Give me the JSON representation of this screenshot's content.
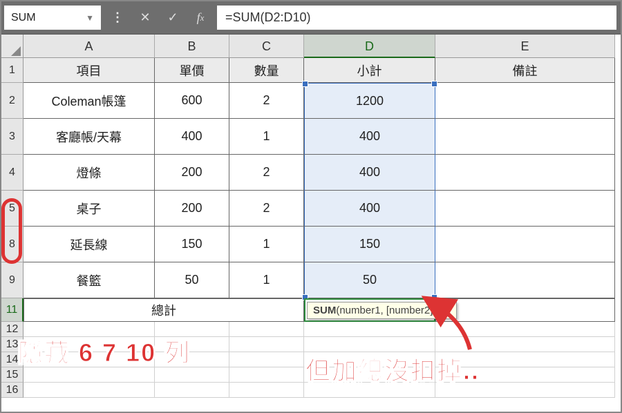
{
  "formula_bar": {
    "name_box": "SUM",
    "formula": "=SUM(D2:D10)"
  },
  "columns": [
    "A",
    "B",
    "C",
    "D",
    "E"
  ],
  "headers": {
    "A": "項目",
    "B": "單價",
    "C": "數量",
    "D": "小計",
    "E": "備註"
  },
  "rows": [
    {
      "num": "2",
      "item": "Coleman帳篷",
      "price": "600",
      "qty": "2",
      "subtotal": "1200"
    },
    {
      "num": "3",
      "item": "客廳帳/天幕",
      "price": "400",
      "qty": "1",
      "subtotal": "400"
    },
    {
      "num": "4",
      "item": "燈條",
      "price": "200",
      "qty": "2",
      "subtotal": "400"
    },
    {
      "num": "5",
      "item": "桌子",
      "price": "200",
      "qty": "2",
      "subtotal": "400"
    },
    {
      "num": "8",
      "item": "延長線",
      "price": "150",
      "qty": "1",
      "subtotal": "150"
    },
    {
      "num": "9",
      "item": "餐籃",
      "price": "50",
      "qty": "1",
      "subtotal": "50"
    }
  ],
  "total_row": {
    "num": "11",
    "label": "總計",
    "formula_prefix": "=SUM(",
    "formula_range": "D2:D10",
    "formula_suffix": ")"
  },
  "blank_rows": [
    "12",
    "13",
    "14",
    "15",
    "16"
  ],
  "tooltip": {
    "fn": "SUM",
    "args": "(number1, [number2], ...)"
  },
  "callouts": {
    "hidden_rows": "隱藏 6 7 10 列",
    "sum_not_deduct": "但加總沒扣掉.."
  }
}
